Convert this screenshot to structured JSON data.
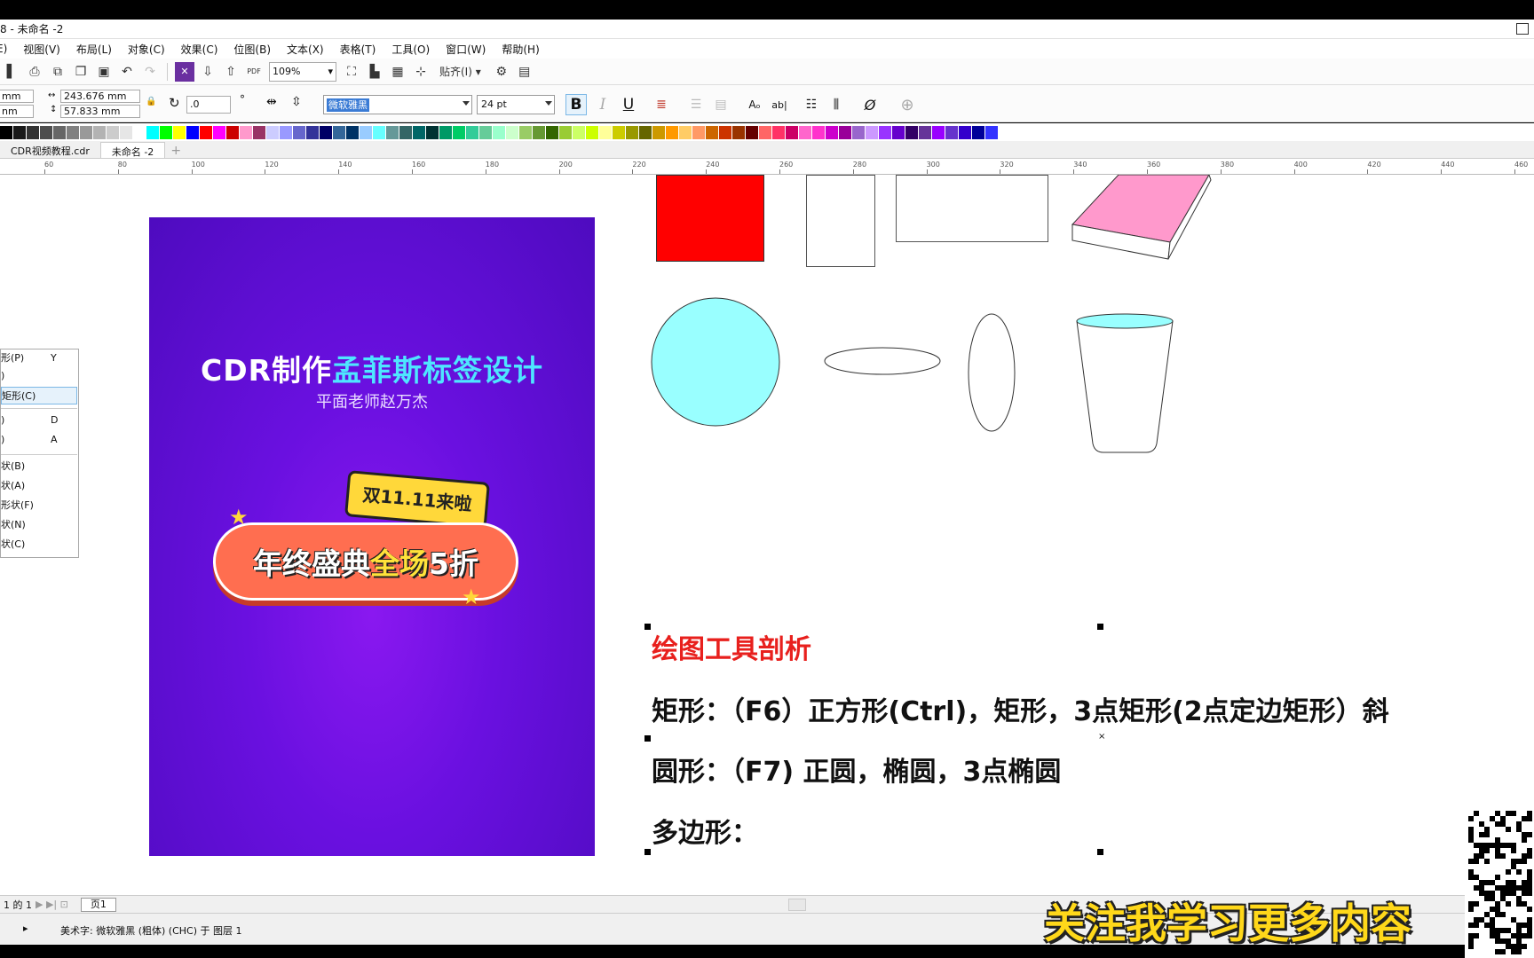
{
  "window": {
    "title": "8 - 未命名 -2"
  },
  "menu": [
    "E)",
    "视图(V)",
    "布局(L)",
    "对象(C)",
    "效果(C)",
    "位图(B)",
    "文本(X)",
    "表格(T)",
    "工具(O)",
    "窗口(W)",
    "帮助(H)"
  ],
  "toolbar": {
    "zoom": "109%",
    "pdf_label": "PDF",
    "snap_label": "贴齐(I)"
  },
  "props": {
    "x_value": "mm",
    "y_value": "nm",
    "width": "243.676 mm",
    "height": "57.833 mm",
    "rotation": ".0",
    "font_name": "微软雅黑",
    "font_size": "24 pt",
    "bold": "B",
    "italic": "I",
    "underline": "U"
  },
  "tabs": [
    {
      "label": "CDR视频教程.cdr",
      "active": false
    },
    {
      "label": "未命名 -2",
      "active": true
    }
  ],
  "ruler_ticks": [
    "60",
    "80",
    "100",
    "120",
    "140",
    "160",
    "180",
    "200",
    "220",
    "240",
    "260",
    "280",
    "300",
    "320",
    "340",
    "360",
    "380",
    "400",
    "420",
    "440",
    "460"
  ],
  "context_menu": [
    {
      "label": "形(P)",
      "key": "Y"
    },
    {
      "label": ")",
      "key": ""
    },
    {
      "label": "矩形(C)",
      "key": ""
    },
    {
      "label": ")",
      "key": "D"
    },
    {
      "label": ")",
      "key": "A"
    },
    {
      "label": "状(B)",
      "key": ""
    },
    {
      "label": "状(A)",
      "key": ""
    },
    {
      "label": "形状(F)",
      "key": ""
    },
    {
      "label": "状(N)",
      "key": ""
    },
    {
      "label": "状(C)",
      "key": ""
    }
  ],
  "poster": {
    "title_white": "CDR制作",
    "title_cyan": "孟菲斯标签设计",
    "subtitle": "平面老师赵万杰",
    "badge": "双11.11来啦",
    "pill_a": "年终盛典",
    "pill_b": "全场",
    "pill_c": "5折"
  },
  "doc": {
    "heading": "绘图工具剖析",
    "line1": "矩形：（F6）正方形(Ctrl)，矩形，3点矩形(2点定边矩形）斜",
    "line2": "圆形：（F7) 正圆，椭圆，3点椭圆",
    "line3": "多边形："
  },
  "pagebar": {
    "page_info": "1 的 1",
    "page_tab": "页1"
  },
  "status": {
    "text": "美术字: 微软雅黑 (粗体) (CHC) 于 图层 1"
  },
  "promo": "关注我学习更多内容",
  "colors": {
    "accent_red": "#ff0000",
    "cyan_fill": "#99ffff",
    "pink_fill": "#ff99cc",
    "poster_purple": "#6a10e0",
    "promo_yellow": "#ffd81a"
  },
  "icons": [
    "undo-icon",
    "redo-icon",
    "gear-icon",
    "import-icon",
    "export-icon",
    "zoom-fit-icon"
  ]
}
